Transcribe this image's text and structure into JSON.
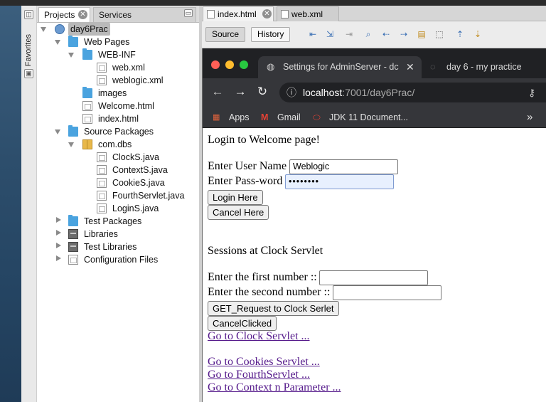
{
  "favorites": {
    "label": "Favorites"
  },
  "project_panel": {
    "tabs": [
      {
        "label": "Projects"
      },
      {
        "label": "Services"
      }
    ],
    "tree": {
      "root": "day6Prac",
      "web_pages": "Web Pages",
      "web_inf": "WEB-INF",
      "web_xml": "web.xml",
      "weblogic_xml": "weblogic.xml",
      "images": "images",
      "welcome_html": "Welcome.html",
      "index_html": "index.html",
      "source_packages": "Source Packages",
      "com_dbs": "com.dbs",
      "files": [
        "ClockS.java",
        "ContextS.java",
        "CookieS.java",
        "FourthServlet.java",
        "LoginS.java"
      ],
      "test_packages": "Test Packages",
      "libraries": "Libraries",
      "test_libraries": "Test Libraries",
      "configuration_files": "Configuration Files"
    }
  },
  "editor": {
    "tabs": [
      {
        "label": "index.html"
      },
      {
        "label": "web.xml"
      }
    ],
    "toolbar": {
      "source": "Source",
      "history": "History"
    }
  },
  "browser": {
    "tabs": [
      {
        "label": "Settings for AdminServer - dc"
      },
      {
        "label": "day 6 - my practice"
      }
    ],
    "address": {
      "host": "localhost",
      "rest": ":7001/day6Prac/"
    },
    "bookmarks": [
      {
        "label": "Apps"
      },
      {
        "label": "Gmail"
      },
      {
        "label": "JDK 11 Document..."
      }
    ],
    "overflow": "»"
  },
  "page": {
    "heading": "Login to Welcome page!",
    "user_label": "Enter User Name",
    "user_value": "Weblogic",
    "pass_label": "Enter Pass-word",
    "pass_value": "••••••••",
    "login_button": "Login Here",
    "cancel_button": "Cancel Here",
    "sessions_heading": "Sessions at Clock Servlet",
    "first_label": "Enter the first number ::",
    "second_label": "Enter the second number ::",
    "get_button": "GET_Request to Clock Serlet",
    "cancel_clicked_button": "CancelClicked",
    "links": [
      "Go to Clock Servlet ...",
      "Go to Cookies Servlet ...",
      "Go to FourthServlet ...",
      "Go to Context n Parameter ..."
    ]
  }
}
